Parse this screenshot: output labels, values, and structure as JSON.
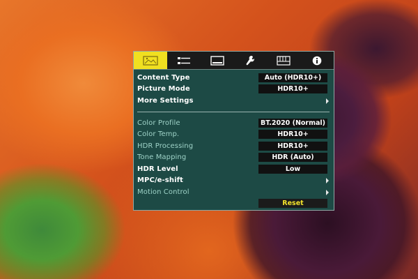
{
  "tabs": [
    {
      "icon": "picture-icon",
      "active": true
    },
    {
      "icon": "sliders-icon",
      "active": false
    },
    {
      "icon": "display-icon",
      "active": false
    },
    {
      "icon": "wrench-icon",
      "active": false
    },
    {
      "icon": "grid-icon",
      "active": false
    },
    {
      "icon": "info-icon",
      "active": false
    }
  ],
  "menu": {
    "content_type": {
      "label": "Content Type",
      "value": "Auto (HDR10+)"
    },
    "picture_mode": {
      "label": "Picture Mode",
      "value": "HDR10+"
    },
    "more_settings": {
      "label": "More Settings"
    },
    "color_profile": {
      "label": "Color Profile",
      "value": "BT.2020 (Normal)"
    },
    "color_temp": {
      "label": "Color Temp.",
      "value": "HDR10+"
    },
    "hdr_processing": {
      "label": "HDR Processing",
      "value": "HDR10+"
    },
    "tone_mapping": {
      "label": "Tone Mapping",
      "value": "HDR (Auto)"
    },
    "hdr_level": {
      "label": "HDR Level",
      "value": "Low"
    },
    "mpc": {
      "label": "MPC/e-shift"
    },
    "motion_control": {
      "label": "Motion Control"
    },
    "reset": {
      "label": "Reset"
    }
  },
  "colors": {
    "menu_bg": "#1d4a45",
    "active_tab": "#f0e020",
    "value_bg": "#111111",
    "dim_label": "#9fd3c8",
    "reset_text": "#f3e22c"
  }
}
